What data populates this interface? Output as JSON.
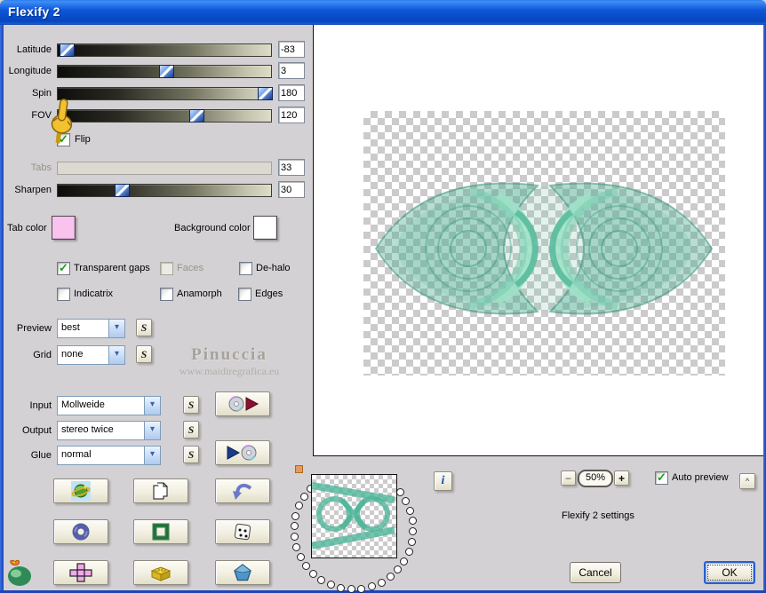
{
  "window": {
    "title": "Flexify 2"
  },
  "sliders": {
    "latitude": {
      "label": "Latitude",
      "value": "-83"
    },
    "longitude": {
      "label": "Longitude",
      "value": "3"
    },
    "spin": {
      "label": "Spin",
      "value": "180"
    },
    "fov": {
      "label": "FOV",
      "value": "120"
    },
    "tabs": {
      "label": "Tabs",
      "value": "33"
    },
    "sharpen": {
      "label": "Sharpen",
      "value": "30"
    }
  },
  "checkboxes": {
    "flip": {
      "label": "Flip",
      "checked": true
    },
    "transparent_gaps": {
      "label": "Transparent gaps",
      "checked": true
    },
    "faces": {
      "label": "Faces",
      "checked": false
    },
    "dehalo": {
      "label": "De-halo",
      "checked": false
    },
    "indicatrix": {
      "label": "Indicatrix",
      "checked": false
    },
    "anamorph": {
      "label": "Anamorph",
      "checked": false
    },
    "edges": {
      "label": "Edges",
      "checked": false
    },
    "auto_preview": {
      "label": "Auto preview",
      "checked": true
    }
  },
  "color_pickers": {
    "tab": {
      "label": "Tab color",
      "color": "#f9c2ef"
    },
    "background": {
      "label": "Background color",
      "color": "#ffffff"
    }
  },
  "combos": {
    "preview": {
      "label": "Preview",
      "value": "best"
    },
    "grid": {
      "label": "Grid",
      "value": "none"
    },
    "input": {
      "label": "Input",
      "value": "Mollweide"
    },
    "output": {
      "label": "Output",
      "value": "stereo twice"
    },
    "glue": {
      "label": "Glue",
      "value": "normal"
    }
  },
  "buttons": {
    "s_label": "S",
    "info_label": "i",
    "zoom_out": "−",
    "zoom_in": "+",
    "collapse": "^",
    "cancel": "Cancel",
    "ok": "OK"
  },
  "zoom_control": {
    "level": "50%"
  },
  "status": {
    "settings_text": "Flexify 2 settings"
  },
  "watermark": {
    "name": "Pinuccia",
    "url": "www.maidiregrafica.eu"
  },
  "dial": {
    "dot_count": 27
  },
  "theme": {
    "teal": "#4fae93",
    "title_blue": "#0f54d6"
  }
}
